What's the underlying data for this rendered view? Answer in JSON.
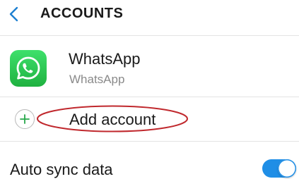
{
  "header": {
    "title": "ACCOUNTS",
    "back_icon": "chevron-left-icon"
  },
  "accounts": [
    {
      "name": "WhatsApp",
      "type": "WhatsApp",
      "icon": "whatsapp-icon",
      "icon_color": "#25d366"
    }
  ],
  "add_account": {
    "label": "Add account",
    "icon": "plus-icon",
    "icon_color": "#27a84a",
    "highlight_color": "#c0282d"
  },
  "auto_sync": {
    "label": "Auto sync data",
    "enabled": true,
    "toggle_color": "#1f8ee6"
  },
  "colors": {
    "accent": "#1f8ee6",
    "back_icon": "#1d7fd1"
  }
}
